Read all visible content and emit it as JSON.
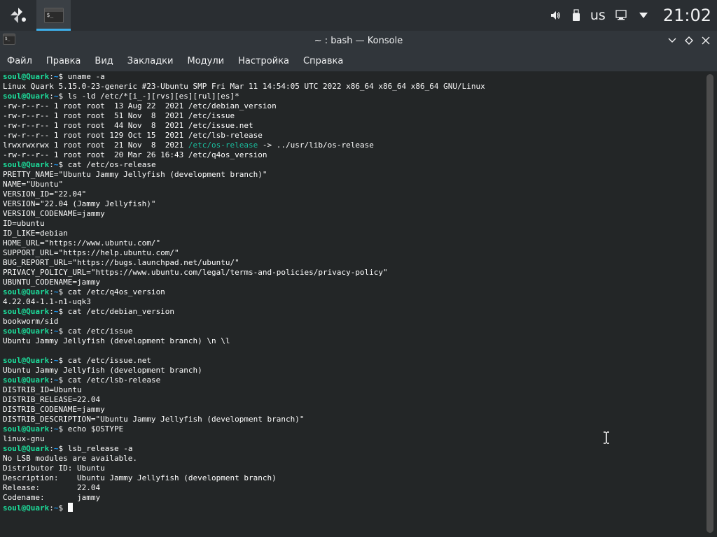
{
  "panel": {
    "launcher_icon": "application-launcher-icon",
    "task_icon_glyph": "$_",
    "keyboard_layout": "us",
    "clock": "21:02"
  },
  "window": {
    "icon_glyph": "$_",
    "title": "~ : bash — Konsole",
    "controls": [
      "minimize-chevron-icon",
      "maximize-diamond-icon",
      "close-x-icon"
    ]
  },
  "menu": [
    "Файл",
    "Правка",
    "Вид",
    "Закладки",
    "Модули",
    "Настройка",
    "Справка"
  ],
  "terminal": {
    "prompt_user": "soul@Quark",
    "prompt_sep": ":",
    "prompt_path": "~",
    "prompt_end": "$ ",
    "lines": [
      {
        "cmd": "uname -a"
      },
      {
        "text": "Linux Quark 5.15.0-23-generic #23-Ubuntu SMP Fri Mar 11 14:54:05 UTC 2022 x86_64 x86_64 x86_64 GNU/Linux"
      },
      {
        "cmd": "ls -ld /etc/*[i_-][rvs][es][rul][es]*"
      },
      {
        "text": "-rw-r--r-- 1 root root  13 Aug 22  2021 /etc/debian_version"
      },
      {
        "text": "-rw-r--r-- 1 root root  51 Nov  8  2021 /etc/issue"
      },
      {
        "text": "-rw-r--r-- 1 root root  44 Nov  8  2021 /etc/issue.net"
      },
      {
        "text": "-rw-r--r-- 1 root root 129 Oct 15  2021 /etc/lsb-release"
      },
      {
        "pre": "lrwxrwxrwx 1 root root  21 Nov  8  2021 ",
        "link": "/etc/os-release",
        "post": " -> ../usr/lib/os-release"
      },
      {
        "text": "-rw-r--r-- 1 root root  20 Mar 26 16:43 /etc/q4os_version"
      },
      {
        "cmd": "cat /etc/os-release"
      },
      {
        "text": "PRETTY_NAME=\"Ubuntu Jammy Jellyfish (development branch)\""
      },
      {
        "text": "NAME=\"Ubuntu\""
      },
      {
        "text": "VERSION_ID=\"22.04\""
      },
      {
        "text": "VERSION=\"22.04 (Jammy Jellyfish)\""
      },
      {
        "text": "VERSION_CODENAME=jammy"
      },
      {
        "text": "ID=ubuntu"
      },
      {
        "text": "ID_LIKE=debian"
      },
      {
        "text": "HOME_URL=\"https://www.ubuntu.com/\""
      },
      {
        "text": "SUPPORT_URL=\"https://help.ubuntu.com/\""
      },
      {
        "text": "BUG_REPORT_URL=\"https://bugs.launchpad.net/ubuntu/\""
      },
      {
        "text": "PRIVACY_POLICY_URL=\"https://www.ubuntu.com/legal/terms-and-policies/privacy-policy\""
      },
      {
        "text": "UBUNTU_CODENAME=jammy"
      },
      {
        "cmd": "cat /etc/q4os_version"
      },
      {
        "text": "4.22.04-1.1-n1-uqk3"
      },
      {
        "cmd": "cat /etc/debian_version"
      },
      {
        "text": "bookworm/sid"
      },
      {
        "cmd": "cat /etc/issue"
      },
      {
        "text": "Ubuntu Jammy Jellyfish (development branch) \\n \\l"
      },
      {
        "text": ""
      },
      {
        "cmd": "cat /etc/issue.net"
      },
      {
        "text": "Ubuntu Jammy Jellyfish (development branch)"
      },
      {
        "cmd": "cat /etc/lsb-release"
      },
      {
        "text": "DISTRIB_ID=Ubuntu"
      },
      {
        "text": "DISTRIB_RELEASE=22.04"
      },
      {
        "text": "DISTRIB_CODENAME=jammy"
      },
      {
        "text": "DISTRIB_DESCRIPTION=\"Ubuntu Jammy Jellyfish (development branch)\""
      },
      {
        "cmd": "echo $OSTYPE"
      },
      {
        "text": "linux-gnu"
      },
      {
        "cmd": "lsb_release -a"
      },
      {
        "text": "No LSB modules are available."
      },
      {
        "text": "Distributor ID: Ubuntu"
      },
      {
        "text": "Description:    Ubuntu Jammy Jellyfish (development branch)"
      },
      {
        "text": "Release:        22.04"
      },
      {
        "text": "Codename:       jammy"
      },
      {
        "cmd": "",
        "cursor": true
      }
    ]
  },
  "colors": {
    "panel_bg": "#2a2e32",
    "accent": "#3daee9",
    "terminal_bg": "#232627",
    "prompt_user": "#1cdc9a",
    "prompt_path": "#1d99f3",
    "symlink": "#1abc9c"
  }
}
